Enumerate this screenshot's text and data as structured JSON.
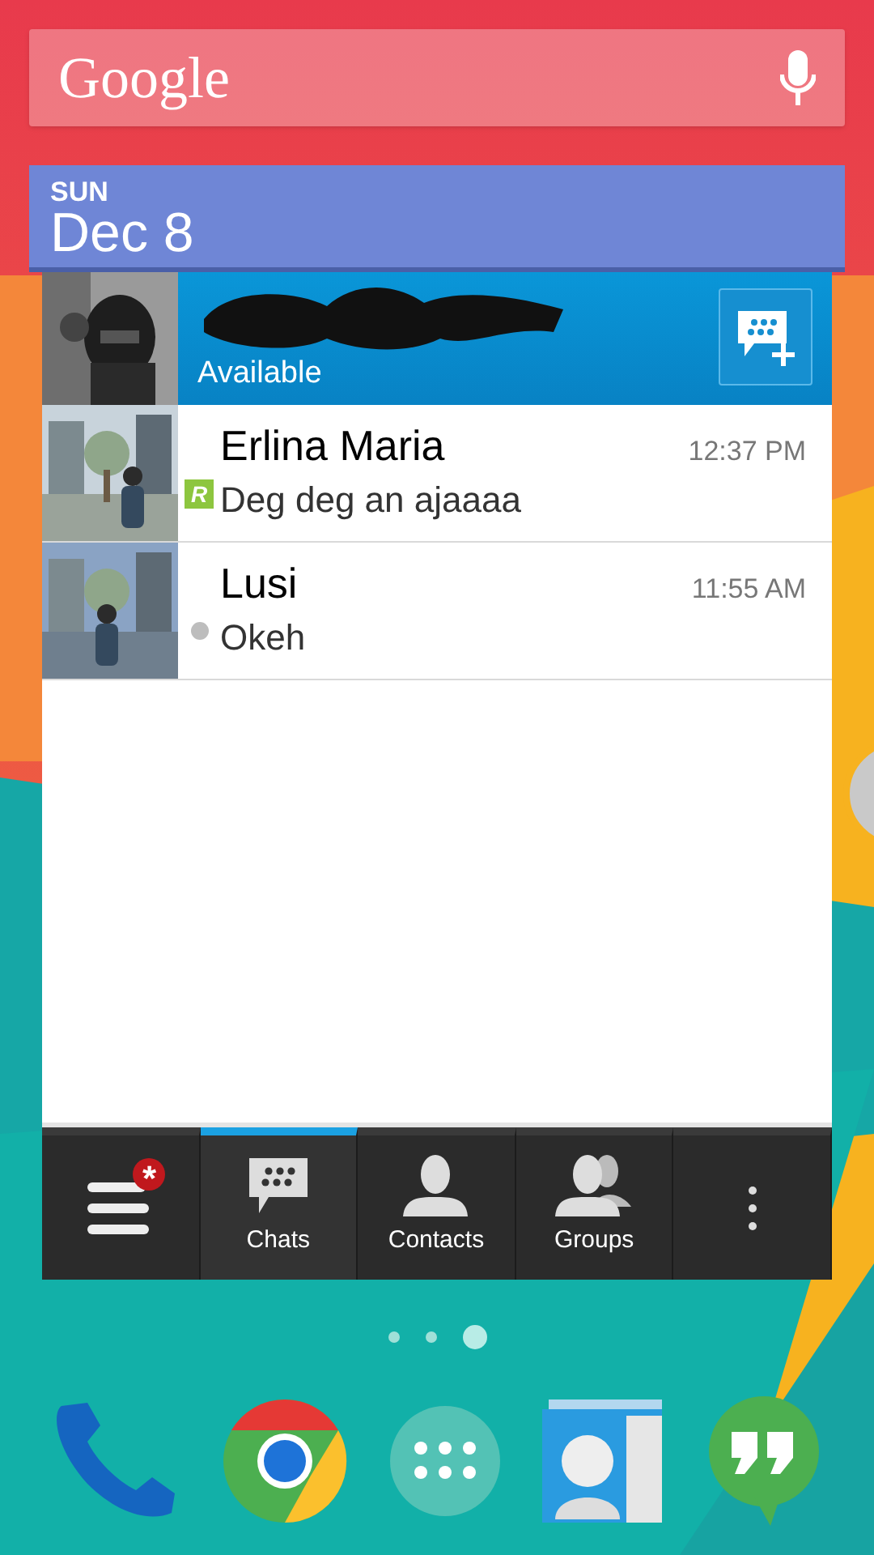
{
  "search": {
    "logo": "Google"
  },
  "date": {
    "weekday": "SUN",
    "day": "Dec 8"
  },
  "profile": {
    "status": "Available"
  },
  "chats": [
    {
      "name": "Erlina Maria",
      "time": "12:37 PM",
      "message": "Deg deg an ajaaaa",
      "indicator": {
        "kind": "letter",
        "glyph": "R"
      }
    },
    {
      "name": "Lusi",
      "time": "11:55 AM",
      "message": "Okeh",
      "indicator": {
        "kind": "dot"
      }
    }
  ],
  "tabs": [
    {
      "kind": "menu",
      "badge": "*",
      "selected": false
    },
    {
      "kind": "chats",
      "label": "Chats",
      "selected": true
    },
    {
      "kind": "contacts",
      "label": "Contacts",
      "selected": false
    },
    {
      "kind": "groups",
      "label": "Groups",
      "selected": false
    },
    {
      "kind": "overflow",
      "selected": false
    }
  ],
  "pages": [
    {
      "selected": false
    },
    {
      "selected": false
    },
    {
      "selected": true
    }
  ]
}
